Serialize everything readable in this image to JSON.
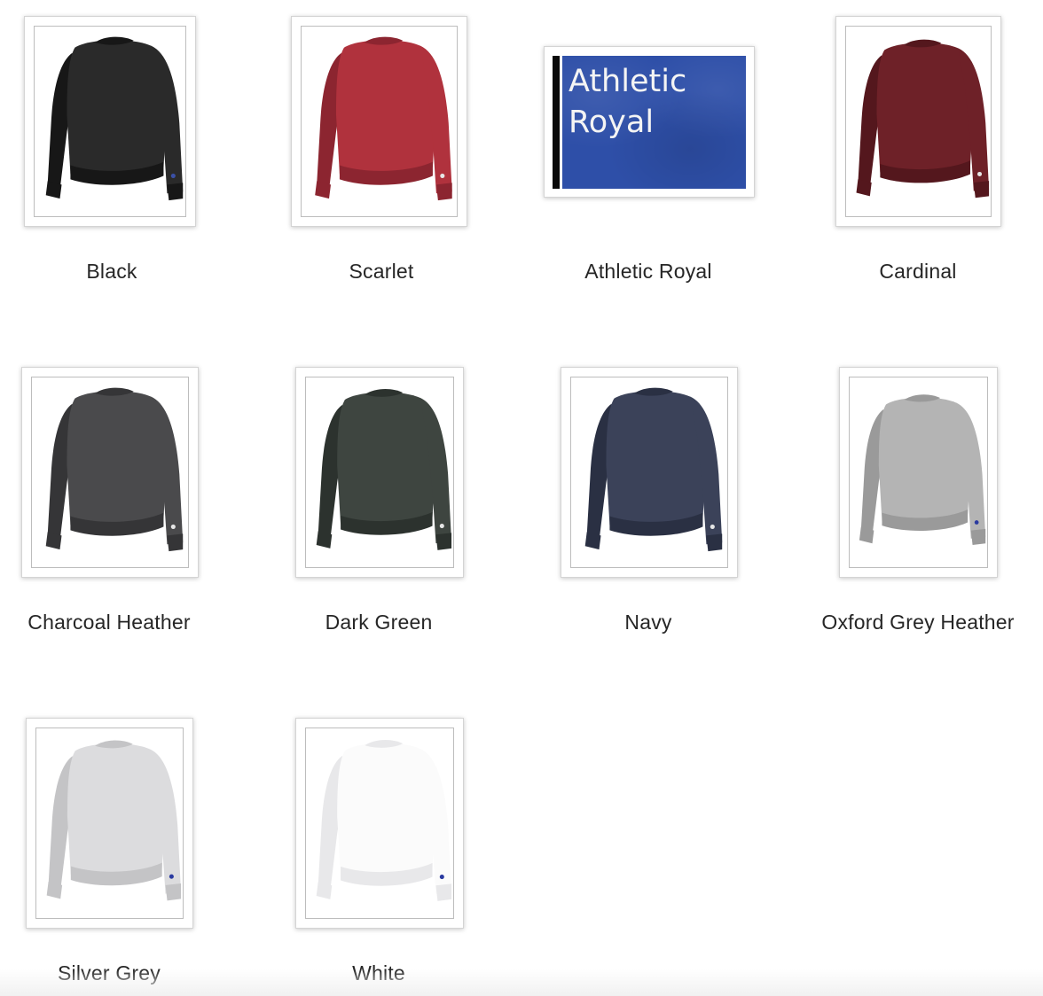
{
  "swatches": [
    {
      "label": "Black",
      "color": "#2a2a2a",
      "shade": "#171717",
      "logo": "#3b50a6"
    },
    {
      "label": "Scarlet",
      "color": "#b0323d",
      "shade": "#8c2530",
      "logo": "#e6e6e6"
    },
    {
      "label": "Athletic Royal",
      "color": "#2e4fa8",
      "swatch_text": "Athletic\nRoyal"
    },
    {
      "label": "Cardinal",
      "color": "#6e2128",
      "shade": "#54171d",
      "logo": "#e6e6e6"
    },
    {
      "label": "Charcoal Heather",
      "color": "#4a4a4c",
      "shade": "#353537",
      "logo": "#e6e6e6"
    },
    {
      "label": "Dark Green",
      "color": "#3e4540",
      "shade": "#2c322e",
      "logo": "#e6e6e6"
    },
    {
      "label": "Navy",
      "color": "#3b4259",
      "shade": "#2a3043",
      "logo": "#e6e6e6"
    },
    {
      "label": "Oxford Grey Heather",
      "color": "#b4b4b4",
      "shade": "#9a9a9a",
      "logo": "#2a3aa0"
    },
    {
      "label": "Silver Grey",
      "color": "#dcdcde",
      "shade": "#c4c4c6",
      "logo": "#2a3aa0"
    },
    {
      "label": "White",
      "color": "#fbfbfb",
      "shade": "#e8e8ea",
      "logo": "#2a3aa0"
    }
  ]
}
